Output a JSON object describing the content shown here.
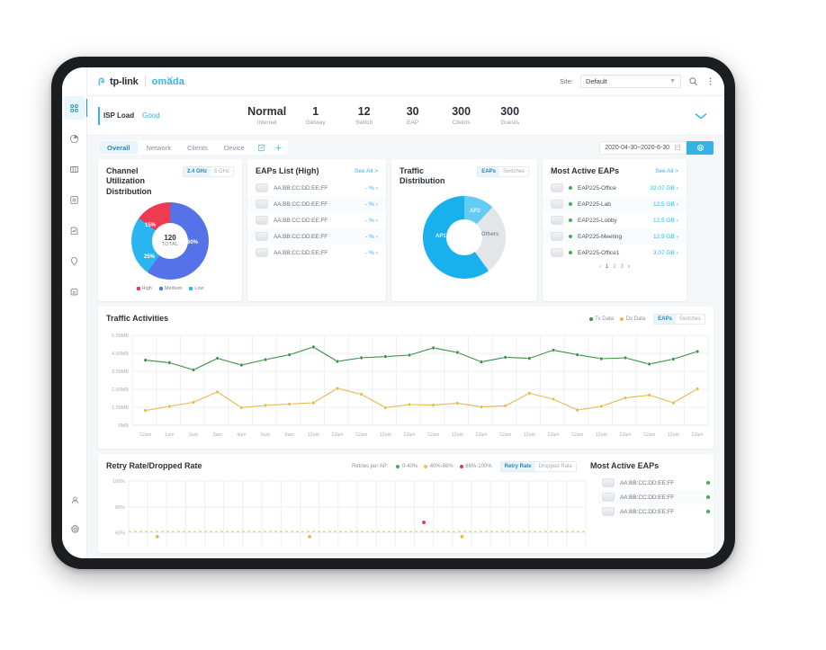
{
  "app": {
    "brand_primary": "tp-link",
    "brand_secondary": "omada",
    "site_label": "Site:",
    "site_value": "Default",
    "accent": "#34b3e4"
  },
  "sidebar": {
    "items": [
      {
        "name": "dashboard",
        "icon": "grid-icon"
      },
      {
        "name": "statistics",
        "icon": "pie-chart-icon"
      },
      {
        "name": "map",
        "icon": "map-icon"
      },
      {
        "name": "devices",
        "icon": "device-icon"
      },
      {
        "name": "insight",
        "icon": "insight-icon"
      },
      {
        "name": "location",
        "icon": "pin-icon"
      },
      {
        "name": "log",
        "icon": "log-icon"
      }
    ],
    "bottom": [
      {
        "name": "account",
        "icon": "user-icon"
      },
      {
        "name": "settings",
        "icon": "gear-icon"
      }
    ]
  },
  "status": {
    "isp_label": "ISP Load",
    "isp_value": "Good",
    "metrics": [
      {
        "value": "Normal",
        "label": "Internet"
      },
      {
        "value": "1",
        "label": "Getway"
      },
      {
        "value": "12",
        "label": "Switch"
      },
      {
        "value": "30",
        "label": "EAP"
      },
      {
        "value": "300",
        "label": "Clients"
      },
      {
        "value": "300",
        "label": "Guests"
      }
    ]
  },
  "tabs": {
    "items": [
      "Overall",
      "Network",
      "Clients",
      "Device"
    ],
    "active": "Overall",
    "edit_icon": "edit-icon",
    "add_icon": "plus-icon"
  },
  "daterange": {
    "value": "2020-04-30~2020-6-30",
    "calendar_icon": "calendar-icon",
    "gear_icon": "gear-icon"
  },
  "channel_card": {
    "title": "Channel Utilization Distribution",
    "band_options": [
      "2.4 GHz",
      "5 GHz"
    ],
    "band_active": "2.4 GHz",
    "total_value": "120",
    "total_label": "TOTAL",
    "legend": [
      {
        "label": "High",
        "color": "#ef3b52"
      },
      {
        "label": "Medium",
        "color": "#5572e8"
      },
      {
        "label": "Low",
        "color": "#29b6f0"
      }
    ]
  },
  "eaps_card": {
    "title": "EAPs List (High)",
    "see_all": "See All >",
    "rows": [
      {
        "mac": "AA:BB:CC:DD:EE:FF",
        "value": "- %"
      },
      {
        "mac": "AA:BB:CC:DD:EE:FF",
        "value": "- %"
      },
      {
        "mac": "AA:BB:CC:DD:EE:FF",
        "value": "- %"
      },
      {
        "mac": "AA:BB:CC:DD:EE:FF",
        "value": "- %"
      },
      {
        "mac": "AA:BB:CC:DD:EE:FF",
        "value": "- %"
      }
    ]
  },
  "traffic_card": {
    "title": "Traffic Distribution",
    "seg_options": [
      "EAPs",
      "Switches"
    ],
    "seg_active": "EAPs",
    "slices": [
      {
        "label": "AP1",
        "value": 60,
        "color": "#18b0ed"
      },
      {
        "label": "AP2",
        "value": 12,
        "color": "#62ccf5"
      },
      {
        "label": "Others",
        "value": 28,
        "color": "#e3e6e9"
      }
    ]
  },
  "most_active_card": {
    "title": "Most Active EAPs",
    "see_all": "See All >",
    "rows": [
      {
        "name": "EAP225-Office",
        "value": "32.07 GB"
      },
      {
        "name": "EAP225-Lab",
        "value": "12.5 GB"
      },
      {
        "name": "EAP225-Lobby",
        "value": "12.5 GB"
      },
      {
        "name": "EAP225-Meeting",
        "value": "12.5 GB"
      },
      {
        "name": "EAP225-Office1",
        "value": "3.07 GB"
      }
    ],
    "pages": [
      "1",
      "2",
      "3"
    ],
    "current_page": "1"
  },
  "traffic_activities": {
    "title": "Traffic Activities",
    "seg_options": [
      "EAPs",
      "Switches"
    ],
    "seg_active": "EAPs"
  },
  "retry_card": {
    "title": "Retry Rate/Dropped Rate",
    "retries_label": "Retries per AP:",
    "legend": [
      {
        "label": "0-40%",
        "color": "#3fae52"
      },
      {
        "label": "40%-66%",
        "color": "#e8c055"
      },
      {
        "label": "66%-100%",
        "color": "#d93a4f"
      }
    ],
    "seg_options": [
      "Retry Rate",
      "Dropped Rate"
    ],
    "seg_active": "Retry Rate"
  },
  "most_active_side": {
    "title": "Most Active EAPs",
    "rows": [
      {
        "mac": "AA:BB:CC:DD:EE:FF"
      },
      {
        "mac": "AA:BB:CC:DD:EE:FF"
      },
      {
        "mac": "AA:BB:CC:DD:EE:FF"
      }
    ]
  },
  "chart_data": [
    {
      "type": "line",
      "id": "traffic-activities",
      "title": "Traffic Activities",
      "xlabel": "",
      "ylabel": "",
      "ylim": [
        0,
        5
      ],
      "yticks": [
        "0MB",
        "1.00MB",
        "2.00MB",
        "3.00MB",
        "4.00MB",
        "5.00MB"
      ],
      "grid": true,
      "legend_position": "top-right",
      "x": [
        "12am",
        "1am",
        "2am",
        "3am",
        "4am",
        "5am",
        "6am",
        "12am",
        "12am",
        "12am",
        "12am",
        "12am",
        "12am",
        "12am",
        "12am",
        "12am",
        "12am",
        "12am",
        "12am",
        "12am",
        "12am",
        "12am",
        "12am",
        "12am"
      ],
      "series": [
        {
          "name": "Tx Data",
          "color": "#3b8f46",
          "values": [
            3.62,
            3.48,
            3.08,
            3.72,
            3.35,
            3.65,
            3.92,
            4.35,
            3.55,
            3.75,
            3.82,
            3.9,
            4.3,
            4.05,
            3.52,
            3.78,
            3.72,
            4.18,
            3.92,
            3.7,
            3.75,
            3.4,
            3.68,
            4.1
          ]
        },
        {
          "name": "Dx Data",
          "color": "#e8b84b",
          "values": [
            0.82,
            1.05,
            1.28,
            1.85,
            0.98,
            1.1,
            1.18,
            1.25,
            2.05,
            1.72,
            0.98,
            1.15,
            1.12,
            1.22,
            1.02,
            1.08,
            1.78,
            1.45,
            0.85,
            1.05,
            1.52,
            1.68,
            1.25,
            2.02
          ]
        }
      ]
    },
    {
      "type": "scatter",
      "id": "retry-rate",
      "title": "Retry Rate/Dropped Rate",
      "ylim": [
        50,
        100
      ],
      "yticks": [
        "60%",
        "80%",
        "100%"
      ],
      "grid": true,
      "threshold": 61,
      "points": [
        {
          "x": 1,
          "y": 57,
          "color": "#e8b84b"
        },
        {
          "x": 9,
          "y": 57,
          "color": "#e8b84b"
        },
        {
          "x": 17,
          "y": 57,
          "color": "#e8b84b"
        },
        {
          "x": 15,
          "y": 68,
          "color": "#d93a4f"
        }
      ]
    }
  ]
}
